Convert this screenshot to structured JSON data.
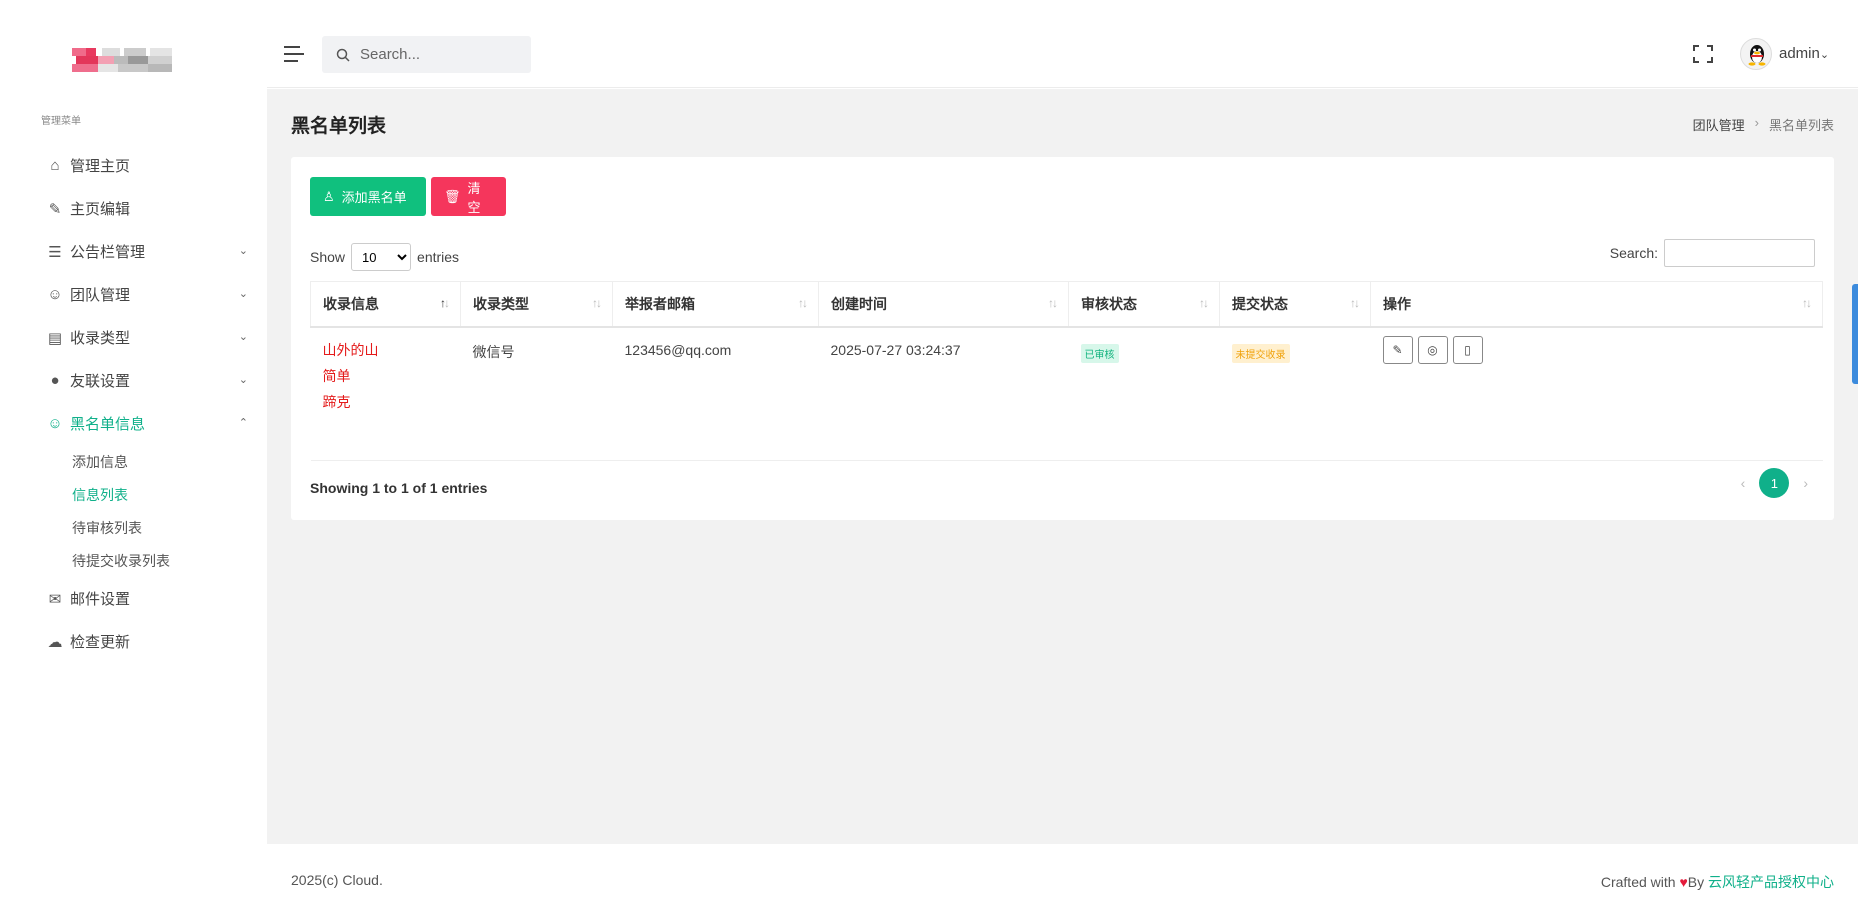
{
  "sidebar": {
    "menu_caption": "管理菜单",
    "items": [
      {
        "label": "管理主页",
        "icon": "home-icon",
        "glyph": "⌂"
      },
      {
        "label": "主页编辑",
        "icon": "edit-icon",
        "glyph": "✎"
      },
      {
        "label": "公告栏管理",
        "icon": "list-icon",
        "glyph": "☰",
        "chevron": "⌄"
      },
      {
        "label": "团队管理",
        "icon": "users-icon",
        "glyph": "☺",
        "chevron": "⌄"
      },
      {
        "label": "收录类型",
        "icon": "grid-icon",
        "glyph": "▤",
        "chevron": "⌄"
      },
      {
        "label": "友联设置",
        "icon": "compass-icon",
        "glyph": "●",
        "chevron": "⌄"
      },
      {
        "label": "黑名单信息",
        "icon": "user-circle-icon",
        "glyph": "☺",
        "chevron": "⌃"
      },
      {
        "label": "邮件设置",
        "icon": "mail-icon",
        "glyph": "✉"
      },
      {
        "label": "检查更新",
        "icon": "cloud-icon",
        "glyph": "☁"
      }
    ],
    "blacklist_sub": [
      {
        "label": "添加信息"
      },
      {
        "label": "信息列表"
      },
      {
        "label": "待审核列表"
      },
      {
        "label": "待提交收录列表"
      }
    ]
  },
  "topbar": {
    "search_placeholder": "Search...",
    "user_name": "admin",
    "user_caret": "⌄"
  },
  "page": {
    "title": "黑名单列表",
    "breadcrumb": [
      "团队管理",
      "黑名单列表"
    ],
    "breadcrumb_sep": "›"
  },
  "toolbar": {
    "add_label": "添加黑名单",
    "add_icon": "user-add-icon",
    "clear_label": "清空",
    "clear_icon": "trash-icon"
  },
  "table_controls": {
    "show_label": "Show",
    "page_size": "10",
    "entries_label": "entries",
    "search_label": "Search:",
    "info": "Showing 1 to 1 of 1 entries"
  },
  "table": {
    "headers": [
      "收录信息",
      "收录类型",
      "举报者邮箱",
      "创建时间",
      "审核状态",
      "提交状态",
      "操作"
    ],
    "rows": [
      {
        "info_lines": [
          "山外的山",
          "简单",
          "蹄克"
        ],
        "type": "微信号",
        "email": "123456@qq.com",
        "created": "2025-07-27 03:24:37",
        "review_status": "已审核",
        "submit_status": "未提交收录"
      }
    ]
  },
  "pagination": {
    "prev": "‹",
    "current": "1",
    "next": "›"
  },
  "footer": {
    "copyright": "2025(c) Cloud.",
    "crafted_prefix": "Crafted with",
    "heart": "♥",
    "by": "By",
    "link_text": "云风轻产品授权中心"
  },
  "colors": {
    "accent": "#10b08a",
    "success": "#10c07e",
    "danger": "#f5365c",
    "text_red": "#e41b1b"
  }
}
